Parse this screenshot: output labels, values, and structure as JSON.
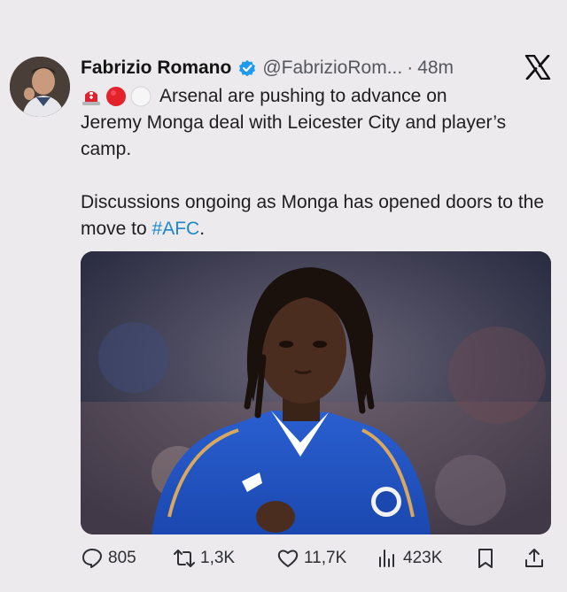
{
  "author": {
    "display_name": "Fabrizio Romano",
    "handle": "@FabrizioRom...",
    "separator": "·",
    "time": "48m",
    "verified_icon": "verified-badge-icon"
  },
  "platform_icon": "x-logo-icon",
  "tweet": {
    "emojis": [
      "siren-emoji",
      "red-circle-emoji",
      "white-circle-emoji"
    ],
    "line1": "Arsenal are pushing to advance on",
    "line2": "Jeremy Monga deal with Leicester City and player’s",
    "line3": "camp.",
    "para2_text": "Discussions ongoing as Monga has opened doors to the move to ",
    "hashtag": "#AFC",
    "para2_end": "."
  },
  "media": {
    "description_icon": "player-photo"
  },
  "actions": {
    "replies": "805",
    "reposts": "1,3K",
    "likes": "11,7K",
    "views": "423K"
  },
  "colors": {
    "background": "#eceaec",
    "hashtag": "#1d88c9",
    "verified": "#1d9bf0"
  }
}
